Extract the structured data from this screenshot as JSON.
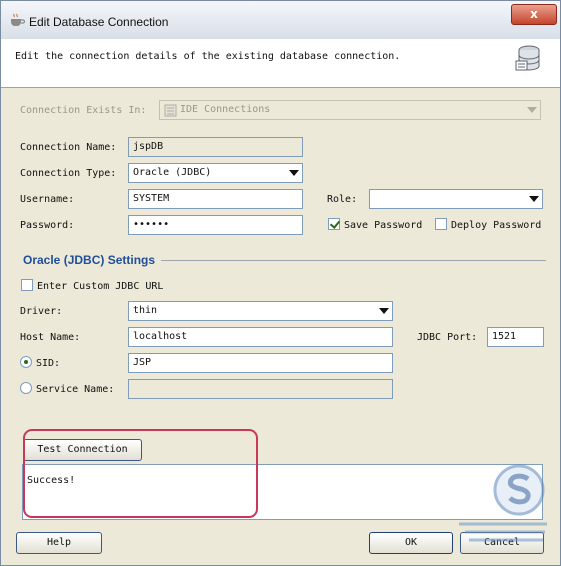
{
  "window": {
    "title": "Edit Database Connection",
    "close_label": "x"
  },
  "header": {
    "description": "Edit the connection details of the existing database connection."
  },
  "form": {
    "connection_exists_in": {
      "label": "Connection Exists In:",
      "value": "IDE Connections"
    },
    "connection_name": {
      "label": "Connection Name:",
      "value": "jspDB"
    },
    "connection_type": {
      "label": "Connection Type:",
      "value": "Oracle (JDBC)"
    },
    "username": {
      "label": "Username:",
      "value": "SYSTEM"
    },
    "role": {
      "label": "Role:",
      "value": ""
    },
    "password": {
      "label": "Password:",
      "value": "••••••"
    },
    "save_password": {
      "label": "Save Password",
      "checked": true
    },
    "deploy_password": {
      "label": "Deploy Password",
      "checked": false
    }
  },
  "oracle_settings": {
    "section_title": "Oracle (JDBC) Settings",
    "custom_url": {
      "label": "Enter Custom JDBC URL",
      "checked": false
    },
    "driver": {
      "label": "Driver:",
      "value": "thin"
    },
    "host_name": {
      "label": "Host Name:",
      "value": "localhost"
    },
    "jdbc_port": {
      "label": "JDBC Port:",
      "value": "1521"
    },
    "sid": {
      "label": "SID:",
      "value": "JSP",
      "selected": true
    },
    "service_name": {
      "label": "Service Name:",
      "value": "",
      "selected": false
    }
  },
  "test": {
    "button_label": "Test Connection",
    "result": "Success!"
  },
  "footer": {
    "help_label": "Help",
    "ok_label": "OK",
    "cancel_label": "Cancel"
  },
  "colors": {
    "section_title": "#1f4e9a",
    "highlight": "#c8385a",
    "close_button": "#c5452b"
  }
}
